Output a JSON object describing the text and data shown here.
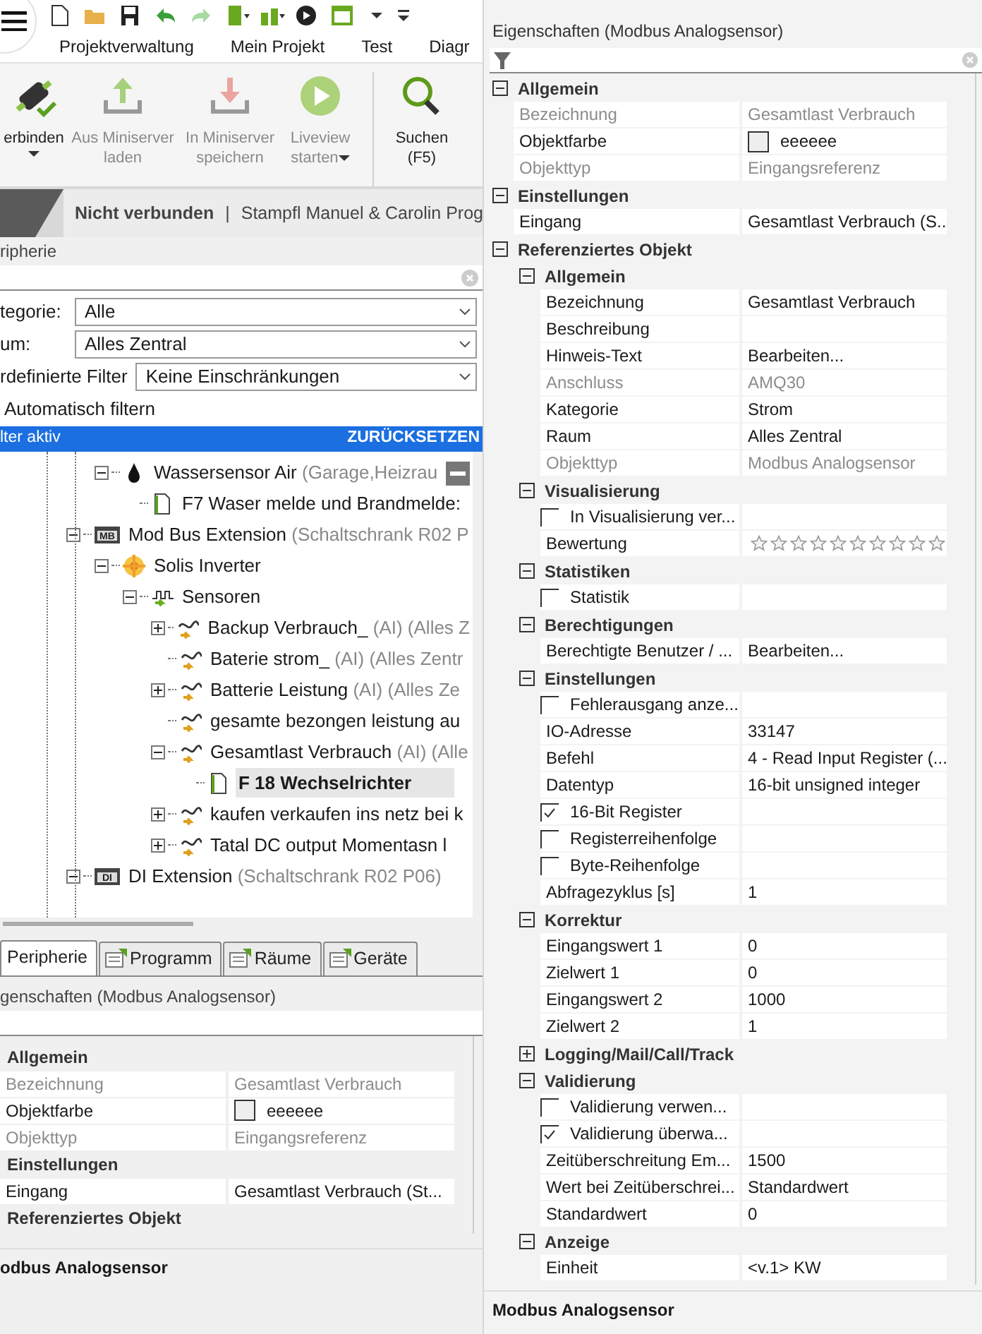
{
  "ribbon_tabs": [
    {
      "label": "Projektverwaltung"
    },
    {
      "label": "Mein Projekt"
    },
    {
      "label": "Test"
    },
    {
      "label": "Diagr"
    }
  ],
  "ribbon_buttons": [
    {
      "kind": "connect",
      "lines": [
        "erbinden"
      ],
      "disabled": false,
      "dropdown": true
    },
    {
      "kind": "upload",
      "lines": [
        "Aus Miniserver",
        "laden"
      ],
      "disabled": true,
      "dropdown": false
    },
    {
      "kind": "download",
      "lines": [
        "In Miniserver",
        "speichern"
      ],
      "disabled": true,
      "dropdown": false
    },
    {
      "kind": "play",
      "lines": [
        "Liveview",
        "starten"
      ],
      "disabled": true,
      "dropdown": true
    },
    {
      "kind": "search",
      "lines": [
        "Suchen",
        "(F5)"
      ],
      "disabled": false,
      "dropdown": false
    }
  ],
  "status_strip": {
    "connection": "Nicht verbunden",
    "separator": "|",
    "project": "Stampfl Manuel & Carolin Prog"
  },
  "periphery_panel": {
    "title": "ripherie",
    "filters": [
      {
        "label": "tegorie:",
        "value": "Alle"
      },
      {
        "label": "um:",
        "value": "Alles Zentral"
      },
      {
        "label": "rdefinierte Filter",
        "value": "Keine Einschränkungen"
      }
    ],
    "auto_filter": {
      "label": "Automatisch filtern"
    },
    "filter_bar": {
      "text": "lter aktiv",
      "action": "ZURÜCKSETZEN"
    },
    "tree": {
      "upper_branch_items": [
        {
          "label": "Wassersensor Air",
          "detail": "(Garage,Heizrau",
          "kind": "drop",
          "expanded": true,
          "selected": false,
          "children": [
            {
              "label": "F7 Waser melde und Brandmelde:",
              "kind": "document",
              "selected": false
            }
          ]
        }
      ],
      "items": [
        {
          "label": "Mod Bus Extension",
          "detail": "(Schaltschrank R02 P",
          "kind": "module",
          "icon_text": "MB",
          "expanded": true,
          "selected": false,
          "children": [
            {
              "label": "Solis Inverter",
              "kind": "flower",
              "expanded": true,
              "selected": false,
              "children": [
                {
                  "label": "Sensoren",
                  "kind": "sensors",
                  "expanded": true,
                  "selected": false,
                  "children": [
                    {
                      "label": "Backup Verbrauch_",
                      "detail": "(AI) (Alles Z",
                      "kind": "analog",
                      "expanded": false,
                      "selected": false
                    },
                    {
                      "label": "Baterie strom_",
                      "detail": "(AI) (Alles Zentr",
                      "kind": "analog",
                      "selected": false
                    },
                    {
                      "label": "Batterie Leistung",
                      "detail": "(AI) (Alles Ze",
                      "kind": "analog",
                      "expanded": false,
                      "selected": false
                    },
                    {
                      "label": "gesamte bezongen leistung au",
                      "kind": "analog",
                      "selected": false
                    },
                    {
                      "label": "Gesamtlast Verbrauch",
                      "detail": "(AI) (Alle",
                      "kind": "analog",
                      "expanded": true,
                      "selected": false,
                      "children": [
                        {
                          "label": "F 18 Wechselrichter",
                          "kind": "document",
                          "selected": true
                        }
                      ]
                    },
                    {
                      "label": "kaufen verkaufen ins netz bei k",
                      "kind": "analog",
                      "expanded": false,
                      "selected": false
                    },
                    {
                      "label": "Tatal DC output  Momentasn l",
                      "kind": "analog",
                      "expanded": false,
                      "selected": false
                    }
                  ]
                }
              ]
            }
          ]
        },
        {
          "label": "DI Extension",
          "detail": "(Schaltschrank R02 P06)",
          "kind": "module",
          "icon_text": "DI",
          "expanded": true,
          "selected": false
        }
      ]
    }
  },
  "bottom_tabs": [
    {
      "label": "Peripherie",
      "selected": true
    },
    {
      "label": "Programm",
      "selected": false
    },
    {
      "label": "Räume",
      "selected": false
    },
    {
      "label": "Geräte",
      "selected": false
    }
  ],
  "left_properties": {
    "title": "genschaften (Modbus Analogsensor)",
    "sections": [
      {
        "title": "Allgemein",
        "rows": [
          {
            "kind": "text",
            "name": "Bezeichnung",
            "value": "Gesamtlast Verbrauch",
            "disabled": true
          },
          {
            "kind": "color",
            "name": "Objektfarbe",
            "value": "eeeeee",
            "color": "#eeeeee"
          },
          {
            "kind": "text",
            "name": "Objekttyp",
            "value": "Eingangsreferenz",
            "disabled": true
          }
        ]
      },
      {
        "title": "Einstellungen",
        "rows": [
          {
            "kind": "text",
            "name": "Eingang",
            "value": "Gesamtlast Verbrauch (St...",
            "disabled": false
          }
        ]
      },
      {
        "title": "Referenziertes Objekt"
      }
    ],
    "description": "odbus Analogsensor"
  },
  "right_properties": {
    "title": "Eigenschaften (Modbus Analogsensor)",
    "sections": [
      {
        "title": "Allgemein",
        "expanded": true,
        "rows": [
          {
            "kind": "text",
            "name": "Bezeichnung",
            "value": "Gesamtlast Verbrauch",
            "disabled": true
          },
          {
            "kind": "color",
            "name": "Objektfarbe",
            "value": "eeeeee",
            "color": "#eeeeee"
          },
          {
            "kind": "text",
            "name": "Objekttyp",
            "value": "Eingangsreferenz",
            "disabled": true
          }
        ]
      },
      {
        "title": "Einstellungen",
        "expanded": true,
        "rows": [
          {
            "kind": "text",
            "name": "Eingang",
            "value": "Gesamtlast Verbrauch (S...",
            "disabled": false
          }
        ]
      },
      {
        "title": "Referenziertes Objekt",
        "expanded": true,
        "sections": [
          {
            "title": "Allgemein",
            "expanded": true,
            "rows": [
              {
                "kind": "text",
                "name": "Bezeichnung",
                "value": "Gesamtlast Verbrauch",
                "disabled": false
              },
              {
                "kind": "text",
                "name": "Beschreibung",
                "disabled": false
              },
              {
                "kind": "text",
                "name": "Hinweis-Text",
                "value": "Bearbeiten...",
                "disabled": false
              },
              {
                "kind": "text",
                "name": "Anschluss",
                "value": "AMQ30",
                "disabled": true
              },
              {
                "kind": "text",
                "name": "Kategorie",
                "value": "Strom",
                "disabled": false
              },
              {
                "kind": "text",
                "name": "Raum",
                "value": "Alles Zentral",
                "disabled": false
              },
              {
                "kind": "text",
                "name": "Objekttyp",
                "value": "Modbus Analogsensor",
                "disabled": true
              }
            ]
          },
          {
            "title": "Visualisierung",
            "expanded": true,
            "rows": [
              {
                "kind": "checkbox",
                "name": "In Visualisierung ver...",
                "checked": false
              },
              {
                "kind": "stars",
                "name": "Bewertung",
                "stars": 0
              }
            ]
          },
          {
            "title": "Statistiken",
            "expanded": true,
            "rows": [
              {
                "kind": "checkbox",
                "name": "Statistik",
                "checked": false
              }
            ]
          },
          {
            "title": "Berechtigungen",
            "expanded": true,
            "rows": [
              {
                "kind": "text",
                "name": "Berechtigte Benutzer / ...",
                "value": "Bearbeiten...",
                "disabled": false
              }
            ]
          },
          {
            "title": "Einstellungen",
            "expanded": true,
            "rows": [
              {
                "kind": "checkbox",
                "name": "Fehlerausgang anze...",
                "checked": false
              },
              {
                "kind": "text",
                "name": "IO-Adresse",
                "value": "33147",
                "disabled": false
              },
              {
                "kind": "text",
                "name": "Befehl",
                "value": "4 - Read Input Register (...",
                "disabled": false
              },
              {
                "kind": "text",
                "name": "Datentyp",
                "value": "16-bit unsigned integer",
                "disabled": false
              },
              {
                "kind": "checkbox",
                "name": "16-Bit Register",
                "checked": true
              },
              {
                "kind": "checkbox",
                "name": "Registerreihenfolge",
                "checked": false
              },
              {
                "kind": "checkbox",
                "name": "Byte-Reihenfolge",
                "checked": false
              },
              {
                "kind": "text",
                "name": "Abfragezyklus [s]",
                "value": "1",
                "disabled": false
              }
            ]
          },
          {
            "title": "Korrektur",
            "expanded": true,
            "rows": [
              {
                "kind": "text",
                "name": "Eingangswert 1",
                "value": "0",
                "disabled": false
              },
              {
                "kind": "text",
                "name": "Zielwert 1",
                "value": "0",
                "disabled": false
              },
              {
                "kind": "text",
                "name": "Eingangswert 2",
                "value": "1000",
                "disabled": false
              },
              {
                "kind": "text",
                "name": "Zielwert 2",
                "value": "1",
                "disabled": false
              }
            ]
          },
          {
            "title": "Logging/Mail/Call/Track",
            "expanded": false
          },
          {
            "title": "Validierung",
            "expanded": true,
            "rows": [
              {
                "kind": "checkbox",
                "name": "Validierung verwen...",
                "checked": false
              },
              {
                "kind": "checkbox",
                "name": "Validierung überwa...",
                "checked": true
              },
              {
                "kind": "text",
                "name": "Zeitüberschreitung Em...",
                "value": "1500",
                "disabled": false
              },
              {
                "kind": "text",
                "name": "Wert bei Zeitüberschrei...",
                "value": "Standardwert",
                "disabled": false
              },
              {
                "kind": "text",
                "name": "Standardwert",
                "value": "0",
                "disabled": false
              }
            ]
          },
          {
            "title": "Anzeige",
            "expanded": true,
            "rows": [
              {
                "kind": "text",
                "name": "Einheit",
                "value": "<v.1> KW",
                "disabled": false
              }
            ]
          }
        ]
      }
    ],
    "description": "Modbus Analogsensor"
  }
}
